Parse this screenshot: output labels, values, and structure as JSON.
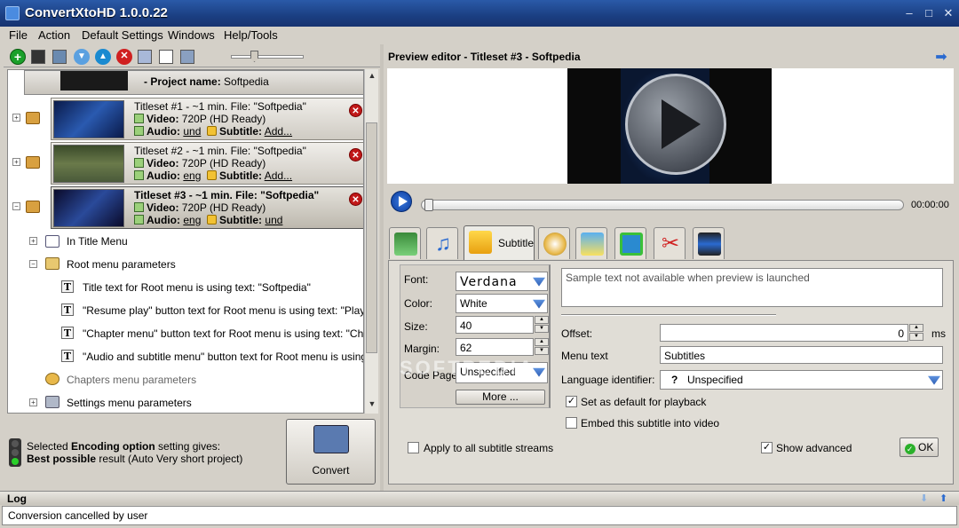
{
  "window": {
    "title": "ConvertXtoHD 1.0.0.22",
    "min": "–",
    "max": "□",
    "close": "✕"
  },
  "menu": [
    "File",
    "Action",
    "Default Settings",
    "Windows",
    "Help/Tools"
  ],
  "toolbar": {
    "icons": [
      "add-icon",
      "save-icon",
      "film-icon",
      "down-icon",
      "up-icon",
      "remove-icon",
      "tools-icon",
      "list-icon",
      "monitor-icon"
    ]
  },
  "project": {
    "label": "- Project name:",
    "name": "Softpedia"
  },
  "titlesets": [
    {
      "title": "Titleset #1 - ~1 min. File: \"Softpedia\"",
      "video_label": "Video:",
      "video": "720P (HD Ready)",
      "audio_label": "Audio:",
      "audio": "und",
      "sub_label": "Subtitle:",
      "sub": "Add..."
    },
    {
      "title": "Titleset #2 - ~1 min. File: \"Softpedia\"",
      "video_label": "Video:",
      "video": "720P (HD Ready)",
      "audio_label": "Audio:",
      "audio": "eng",
      "sub_label": "Subtitle:",
      "sub": "Add..."
    },
    {
      "title": "Titleset #3 - ~1 min. File: \"Softpedia\"",
      "video_label": "Video:",
      "video": "720P (HD Ready)",
      "audio_label": "Audio:",
      "audio": "eng",
      "sub_label": "Subtitle:",
      "sub": "und"
    }
  ],
  "tree": {
    "in_title_menu": "In Title Menu",
    "root_menu_params": "Root menu parameters",
    "root_items": [
      "Title text for Root menu is using text: \"Softpedia\"",
      "\"Resume play\" button text for Root menu is using text: \"Play\"",
      "\"Chapter menu\" button text for Root menu is using text: \"Cha...",
      "\"Audio and subtitle menu\" button text for Root menu is using t..."
    ],
    "chapters_menu": "Chapters menu parameters",
    "settings_menu": "Settings menu parameters"
  },
  "status": {
    "line1_pre": "Selected ",
    "line1_bold": "Encoding option",
    "line1_post": " setting gives:",
    "line2_bold": "Best possible",
    "line2_post": " result (Auto Very short project)"
  },
  "convert_label": "Convert",
  "preview": {
    "title": "Preview editor - Titleset #3 - Softpedia",
    "time": "00:00:00"
  },
  "tabs": {
    "active_label": "Subtitle"
  },
  "subtitle": {
    "font_label": "Font:",
    "font_value": "Verdana",
    "color_label": "Color:",
    "color_value": "White",
    "size_label": "Size:",
    "size_value": "40",
    "margin_label": "Margin:",
    "margin_value": "62",
    "codepage_label": "Code Page:",
    "codepage_value": "Unspecified",
    "more_label": "More ...",
    "sample_text": "Sample text not available when preview is launched",
    "offset_label": "Offset:",
    "offset_value": "0",
    "offset_unit": "ms",
    "menutext_label": "Menu text",
    "menutext_value": "Subtitles",
    "lang_label": "Language identifier:",
    "lang_icon": "?",
    "lang_value": "Unspecified",
    "default_playback": "Set as default for playback",
    "embed": "Embed this subtitle into video",
    "apply_all": "Apply to all subtitle streams",
    "show_advanced": "Show advanced",
    "ok_label": "OK"
  },
  "watermark": "SOFTPEDIA",
  "log": {
    "title": "Log",
    "message": "Conversion cancelled by user"
  }
}
